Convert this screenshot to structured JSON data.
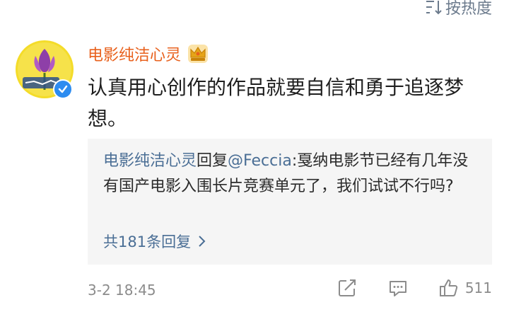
{
  "sort": {
    "label": "按热度",
    "icon": "sort-icon"
  },
  "comment": {
    "avatar_icon": "avatar-lotus-icon",
    "verified_icon": "verified-check-icon",
    "username": "电影纯洁心灵",
    "badge_icon": "crown-badge-icon",
    "text": "认真用心创作的作品就要自信和勇于追逐梦想。"
  },
  "reply_box": {
    "author": "电影纯洁心灵",
    "reply_word": "回复",
    "mention": "@Feccia",
    "text": ":戛纳电影节已经有几年没有国产电影入围长片竞赛单元了，我们试试不行吗?",
    "count_label": "共181条回复",
    "chevron_icon": "chevron-right-icon"
  },
  "footer": {
    "timestamp": "3-2 18:45",
    "share_icon": "share-icon",
    "comment_icon": "comment-icon",
    "like_icon": "thumbs-up-icon",
    "like_count": "511"
  },
  "colors": {
    "username": "#e8601c",
    "link": "#4a6e95",
    "meta": "#8c8c8c",
    "verified": "#2d8cf0"
  }
}
